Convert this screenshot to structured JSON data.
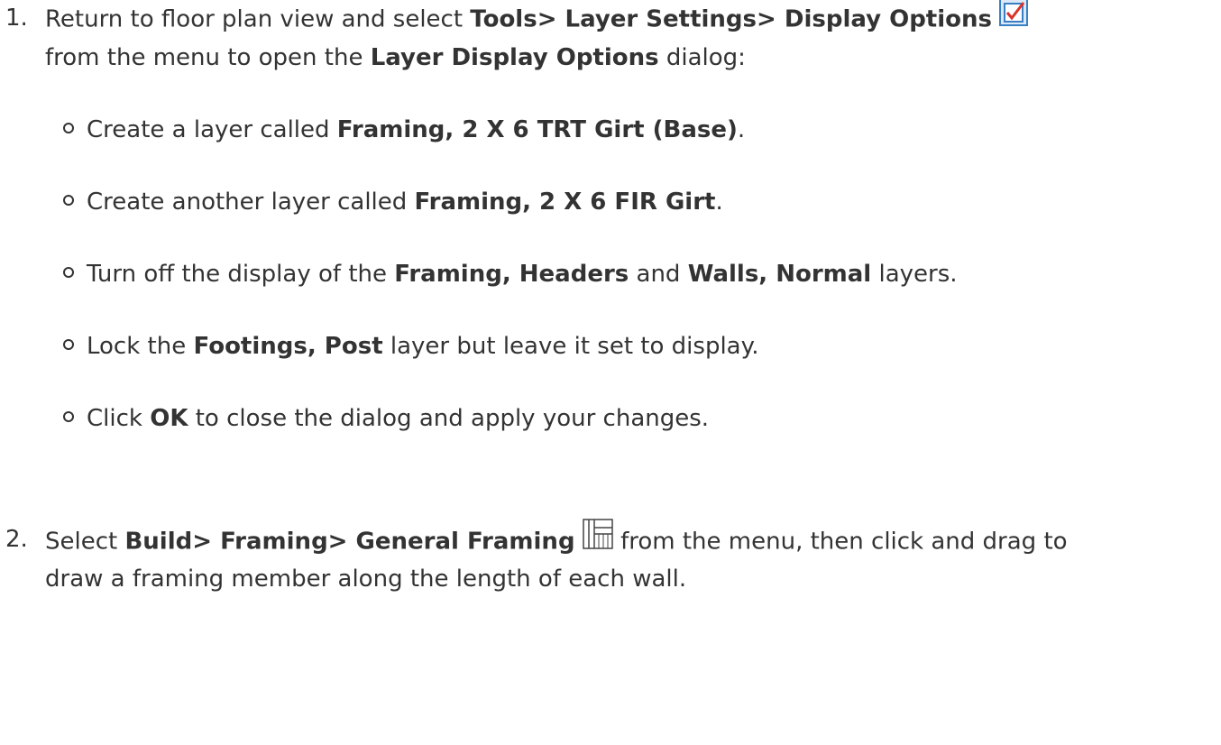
{
  "step1": {
    "number": "1.",
    "line1_pre": "Return to floor plan view and select ",
    "line1_bold": "Tools> Layer Settings> Display Options",
    "icon": "checkbox-icon",
    "line2_pre": "from the menu to open the ",
    "line2_bold": "Layer Display Options",
    "line2_post": " dialog:",
    "bullets": [
      {
        "pre": "Create a layer called ",
        "b1": "Framing, 2 X 6 TRT Girt (Base)",
        "mid": ".",
        "b2": "",
        "post": ""
      },
      {
        "pre": "Create another layer called ",
        "b1": "Framing, 2 X 6 FIR Girt",
        "mid": ".",
        "b2": "",
        "post": ""
      },
      {
        "pre": "Turn off the display of the ",
        "b1": "Framing, Headers",
        "mid": " and ",
        "b2": "Walls, Normal",
        "post": " layers."
      },
      {
        "pre": "Lock the ",
        "b1": "Footings, Post",
        "mid": " layer but leave it set to display.",
        "b2": "",
        "post": ""
      },
      {
        "pre": "Click ",
        "b1": "OK",
        "mid": " to close the dialog and apply your changes.",
        "b2": "",
        "post": ""
      }
    ]
  },
  "step2": {
    "number": "2.",
    "line1_pre": "Select ",
    "line1_bold": "Build> Framing> General Framing",
    "icon": "framing-icon",
    "line1_post": " from the menu, then click and drag to",
    "line2": "draw a framing member along the length of each wall."
  },
  "colors": {
    "text": "#333333",
    "icon_blue": "#3a7fc4",
    "check_red": "#d9332b"
  }
}
